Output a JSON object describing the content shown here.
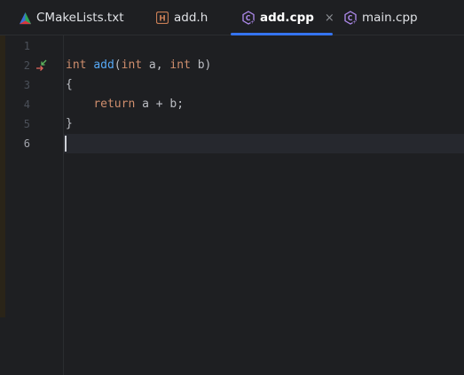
{
  "tabs": [
    {
      "label": "CMakeLists.txt",
      "icon": "cmake-icon",
      "active": false
    },
    {
      "label": "add.h",
      "icon": "header-file-icon",
      "active": false
    },
    {
      "label": "add.cpp",
      "icon": "cpp-file-icon",
      "active": true,
      "close": "×"
    },
    {
      "label": "main.cpp",
      "icon": "cpp-file-icon",
      "active": false
    }
  ],
  "editor": {
    "line_numbers": [
      "1",
      "2",
      "3",
      "4",
      "5",
      "6"
    ],
    "current_line": "6",
    "lines": [
      {
        "tokens": []
      },
      {
        "tokens": [
          {
            "t": "int",
            "k": "kw"
          },
          {
            "t": " ",
            "k": ""
          },
          {
            "t": "add",
            "k": "fn"
          },
          {
            "t": "(",
            "k": ""
          },
          {
            "t": "int",
            "k": "kw"
          },
          {
            "t": " a, ",
            "k": ""
          },
          {
            "t": "int",
            "k": "kw"
          },
          {
            "t": " b)",
            "k": ""
          }
        ]
      },
      {
        "tokens": [
          {
            "t": "{",
            "k": ""
          }
        ]
      },
      {
        "tokens": [
          {
            "t": "    ",
            "k": ""
          },
          {
            "t": "return",
            "k": "kw"
          },
          {
            "t": " a + b;",
            "k": ""
          }
        ]
      },
      {
        "tokens": [
          {
            "t": "}",
            "k": ""
          }
        ]
      },
      {
        "tokens": []
      }
    ],
    "gutter_marker": "navigate-to-declaration-icon"
  },
  "colors": {
    "background": "#1e1f22",
    "keyword": "#cf8e6d",
    "function": "#56a8f5",
    "text": "#bcbec4",
    "accent": "#3574f0"
  }
}
